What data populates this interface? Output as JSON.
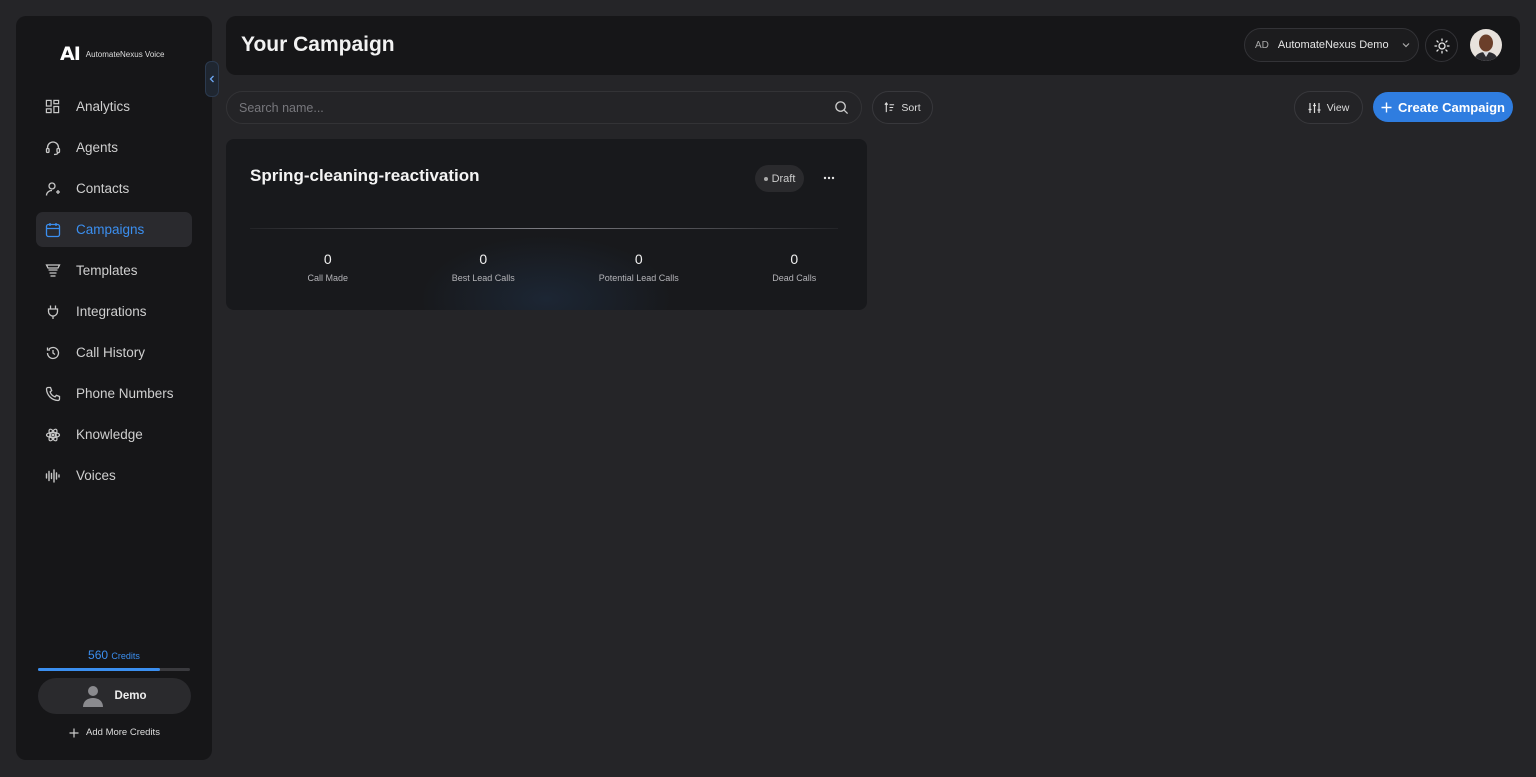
{
  "brand": {
    "logo_mark": "AI",
    "name": "AutomateNexus Voice"
  },
  "sidebar": {
    "items": [
      {
        "label": "Analytics",
        "icon": "grid-icon",
        "active": false
      },
      {
        "label": "Agents",
        "icon": "headset-icon",
        "active": false
      },
      {
        "label": "Contacts",
        "icon": "user-icon",
        "active": false
      },
      {
        "label": "Campaigns",
        "icon": "calendar-icon",
        "active": true
      },
      {
        "label": "Templates",
        "icon": "funnel-icon",
        "active": false
      },
      {
        "label": "Integrations",
        "icon": "plug-icon",
        "active": false
      },
      {
        "label": "Call History",
        "icon": "history-icon",
        "active": false
      },
      {
        "label": "Phone Numbers",
        "icon": "phone-icon",
        "active": false
      },
      {
        "label": "Knowledge",
        "icon": "atom-icon",
        "active": false
      },
      {
        "label": "Voices",
        "icon": "waveform-icon",
        "active": false
      }
    ],
    "credits": {
      "amount": "560",
      "unit": "Credits",
      "usage_fraction": 0.8
    },
    "user": {
      "name": "Demo"
    },
    "add_credits_label": "Add More Credits"
  },
  "header": {
    "title": "Your Campaign",
    "org": {
      "initials": "AD",
      "name": "AutomateNexus Demo"
    }
  },
  "toolbar": {
    "search_placeholder": "Search name...",
    "sort_label": "Sort",
    "view_label": "View",
    "create_label": "Create Campaign"
  },
  "campaigns": [
    {
      "name": "Spring-cleaning-reactivation",
      "status": "Draft",
      "stats": [
        {
          "value": "0",
          "label": "Call Made"
        },
        {
          "value": "0",
          "label": "Best Lead Calls"
        },
        {
          "value": "0",
          "label": "Potential Lead Calls"
        },
        {
          "value": "0",
          "label": "Dead Calls"
        }
      ]
    }
  ],
  "colors": {
    "accent": "#2f7de0",
    "active_text": "#3b8ff0",
    "background": "#252528",
    "panel": "#161618"
  }
}
